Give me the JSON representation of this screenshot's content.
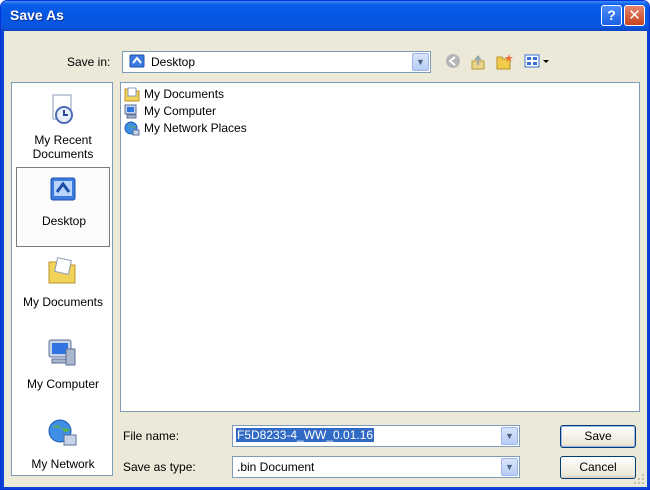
{
  "window": {
    "title": "Save As",
    "help_glyph": "?",
    "close_glyph": "✕"
  },
  "save_in": {
    "label": "Save in:",
    "value": "Desktop"
  },
  "places": [
    {
      "id": "recent",
      "label_line1": "My Recent",
      "label_line2": "Documents"
    },
    {
      "id": "desktop",
      "label_line1": "Desktop"
    },
    {
      "id": "mydocs",
      "label_line1": "My Documents"
    },
    {
      "id": "mycomputer",
      "label_line1": "My Computer"
    },
    {
      "id": "network",
      "label_line1": "My Network"
    }
  ],
  "files": [
    {
      "name": "My Documents",
      "icon": "folder-documents-icon"
    },
    {
      "name": "My Computer",
      "icon": "computer-icon"
    },
    {
      "name": "My Network Places",
      "icon": "network-places-icon"
    }
  ],
  "file_name": {
    "label": "File name:",
    "value": "F5D8233-4_WW_0.01.16"
  },
  "save_as_type": {
    "label": "Save as type:",
    "value": ".bin Document"
  },
  "buttons": {
    "save": "Save",
    "cancel": "Cancel"
  },
  "colors": {
    "titlebar": "#0456e3",
    "selection": "#316ac5",
    "dialog_bg": "#ece9d8"
  }
}
